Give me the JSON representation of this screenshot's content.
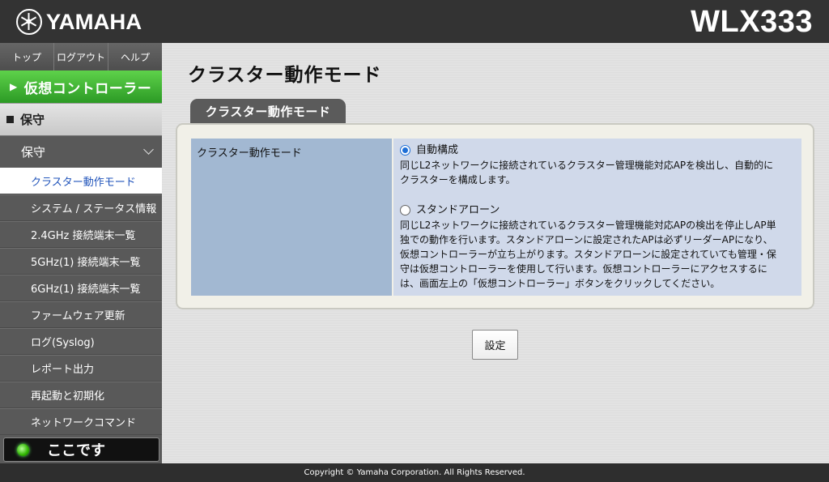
{
  "header": {
    "brand": "YAMAHA",
    "model": "WLX333"
  },
  "sidebar": {
    "topnav": [
      {
        "label": "トップ"
      },
      {
        "label": "ログアウト"
      },
      {
        "label": "ヘルプ"
      }
    ],
    "controller_button": "仮想コントローラー",
    "section": "保守",
    "group": "保守",
    "items": [
      {
        "label": "クラスター動作モード",
        "active": true
      },
      {
        "label": "システム / ステータス情報"
      },
      {
        "label": "2.4GHz 接続端末一覧"
      },
      {
        "label": "5GHz(1) 接続端末一覧"
      },
      {
        "label": "6GHz(1) 接続端末一覧"
      },
      {
        "label": "ファームウェア更新"
      },
      {
        "label": "ログ(Syslog)"
      },
      {
        "label": "レポート出力"
      },
      {
        "label": "再起動と初期化"
      },
      {
        "label": "ネットワークコマンド"
      }
    ],
    "here_button": "ここです"
  },
  "main": {
    "title": "クラスター動作モード",
    "tab": "クラスター動作モード",
    "field_label": "クラスター動作モード",
    "options": [
      {
        "title": "自動構成",
        "selected": true,
        "desc_lines": [
          "同じL2ネットワークに接続されているクラスター管理機能対応APを検出し、自動的に",
          "クラスターを構成します。"
        ]
      },
      {
        "title": "スタンドアローン",
        "selected": false,
        "desc_lines": [
          "同じL2ネットワークに接続されているクラスター管理機能対応APの検出を停止しAP単",
          "独での動作を行います。スタンドアローンに設定されたAPは必ずリーダーAPになり、",
          "仮想コントローラーが立ち上がります。スタンドアローンに設定されていても管理・保",
          "守は仮想コントローラーを使用して行います。仮想コントローラーにアクセスするに",
          "は、画面左上の「仮想コントローラー」ボタンをクリックしてください。"
        ]
      }
    ],
    "submit_label": "設定"
  },
  "footer": {
    "copyright": "Copyright © Yamaha Corporation. All Rights Reserved."
  },
  "colors": {
    "header_bg": "#333333",
    "controller_green": "#2c9a25",
    "label_cell": "#a2b8d2",
    "value_cell": "#d0d9ea",
    "active_link": "#2255bb"
  }
}
